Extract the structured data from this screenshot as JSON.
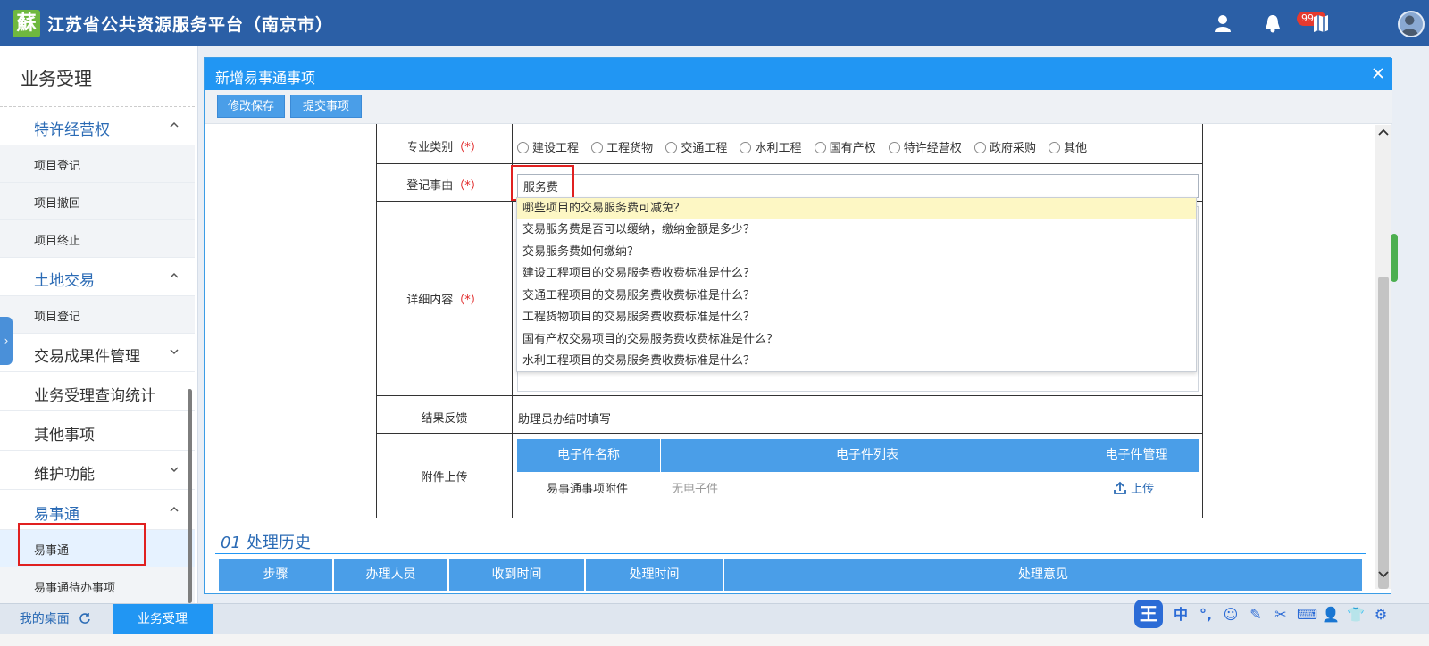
{
  "header": {
    "logo_glyph": "蘇",
    "title": "江苏省公共资源服务平台（南京市）",
    "notification_badge": "99+",
    "icons": [
      "user-icon",
      "bell-icon",
      "map-icon",
      "avatar"
    ]
  },
  "sidebar": {
    "title": "业务受理",
    "sections": [
      {
        "label": "特许经营权",
        "expanded": true
      },
      {
        "label": "土地交易",
        "expanded": true
      },
      {
        "label": "交易成果件管理",
        "expanded": false
      },
      {
        "label": "业务受理查询统计"
      },
      {
        "label": "其他事项"
      },
      {
        "label": "维护功能",
        "expanded": false
      },
      {
        "label": "易事通",
        "expanded": true
      }
    ],
    "items": {
      "franchise": [
        "项目登记",
        "项目撤回",
        "项目终止"
      ],
      "land": [
        "项目登记"
      ],
      "yishitong": [
        "易事通",
        "易事通待办事项"
      ]
    },
    "side_tab_glyph": "›"
  },
  "modal": {
    "title": "新增易事通事项",
    "close_glyph": "×",
    "toolbar": {
      "save_label": "修改保存",
      "submit_label": "提交事项"
    }
  },
  "form": {
    "category_label": "专业类别",
    "req_mark": "（*）",
    "categories": [
      "建设工程",
      "工程货物",
      "交通工程",
      "水利工程",
      "国有产权",
      "特许经营权",
      "政府采购",
      "其他"
    ],
    "reason_label": "登记事由",
    "reason_value": "服务费",
    "detail_label": "详细内容",
    "suggestions": [
      "哪些项目的交易服务费可减免？",
      "交易服务费是否可以缓纳，缴纳金额是多少？",
      "交易服务费如何缴纳？",
      "建设工程项目的交易服务费收费标准是什么？",
      "交通工程项目的交易服务费收费标准是什么？",
      "工程货物项目的交易服务费收费标准是什么？",
      "国有产权交易项目的交易服务费收费标准是什么？",
      "水利工程项目的交易服务费收费标准是什么？"
    ],
    "result_label": "结果反馈",
    "result_value": "助理员办结时填写",
    "attachment_label": "附件上传",
    "attachment_headers": [
      "电子件名称",
      "电子件列表",
      "电子件管理"
    ],
    "attachment_row": {
      "name": "易事通事项附件",
      "list": "无电子件",
      "action": "上传"
    }
  },
  "history": {
    "number": "01",
    "title": "处理历史",
    "headers": [
      "步骤",
      "办理人员",
      "收到时间",
      "处理时间",
      "处理意见"
    ]
  },
  "bottom": {
    "tab_desktop": "我的桌面",
    "tab_business": "业务受理"
  },
  "ime": {
    "main": "王",
    "lang": "中",
    "punct": "°,",
    "emoji": "☺",
    "pen": "✎",
    "scissors": "✂",
    "keyboard": "⌨",
    "person": "👤",
    "shirt": "👕",
    "gear": "⚙"
  },
  "colors": {
    "header": "#2b5fa6",
    "accent": "#2196f3",
    "table_head": "#4a9ee8",
    "required": "#e02020",
    "highlight": "#fdf7c4"
  }
}
